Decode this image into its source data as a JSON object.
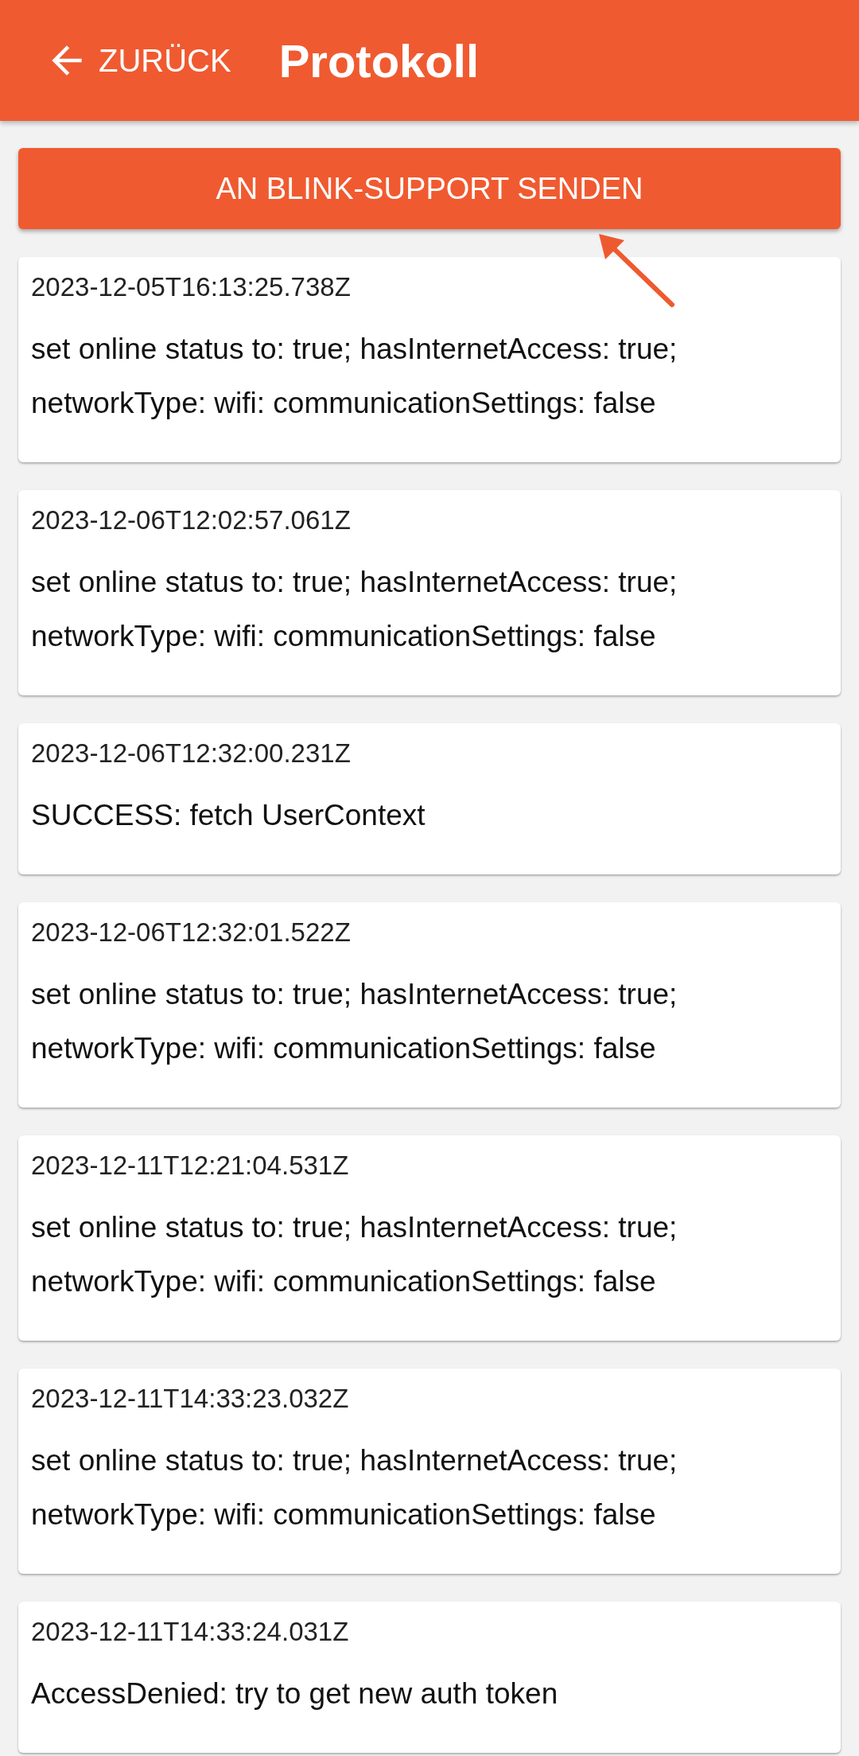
{
  "header": {
    "back_label": "ZURÜCK",
    "title": "Protokoll"
  },
  "send_button": {
    "label": "AN BLINK-SUPPORT SENDEN"
  },
  "log_entries": [
    {
      "timestamp": "2023-12-05T16:13:25.738Z",
      "message": "set online status to: true; hasInternetAccess: true; networkType: wifi: communicationSettings: false"
    },
    {
      "timestamp": "2023-12-06T12:02:57.061Z",
      "message": "set online status to: true; hasInternetAccess: true; networkType: wifi: communicationSettings: false"
    },
    {
      "timestamp": "2023-12-06T12:32:00.231Z",
      "message": "SUCCESS: fetch UserContext"
    },
    {
      "timestamp": "2023-12-06T12:32:01.522Z",
      "message": "set online status to: true; hasInternetAccess: true; networkType: wifi: communicationSettings: false"
    },
    {
      "timestamp": "2023-12-11T12:21:04.531Z",
      "message": "set online status to: true; hasInternetAccess: true; networkType: wifi: communicationSettings: false"
    },
    {
      "timestamp": "2023-12-11T14:33:23.032Z",
      "message": "set online status to: true; hasInternetAccess: true; networkType: wifi: communicationSettings: false"
    },
    {
      "timestamp": "2023-12-11T14:33:24.031Z",
      "message": "AccessDenied: try to get new auth token"
    }
  ]
}
